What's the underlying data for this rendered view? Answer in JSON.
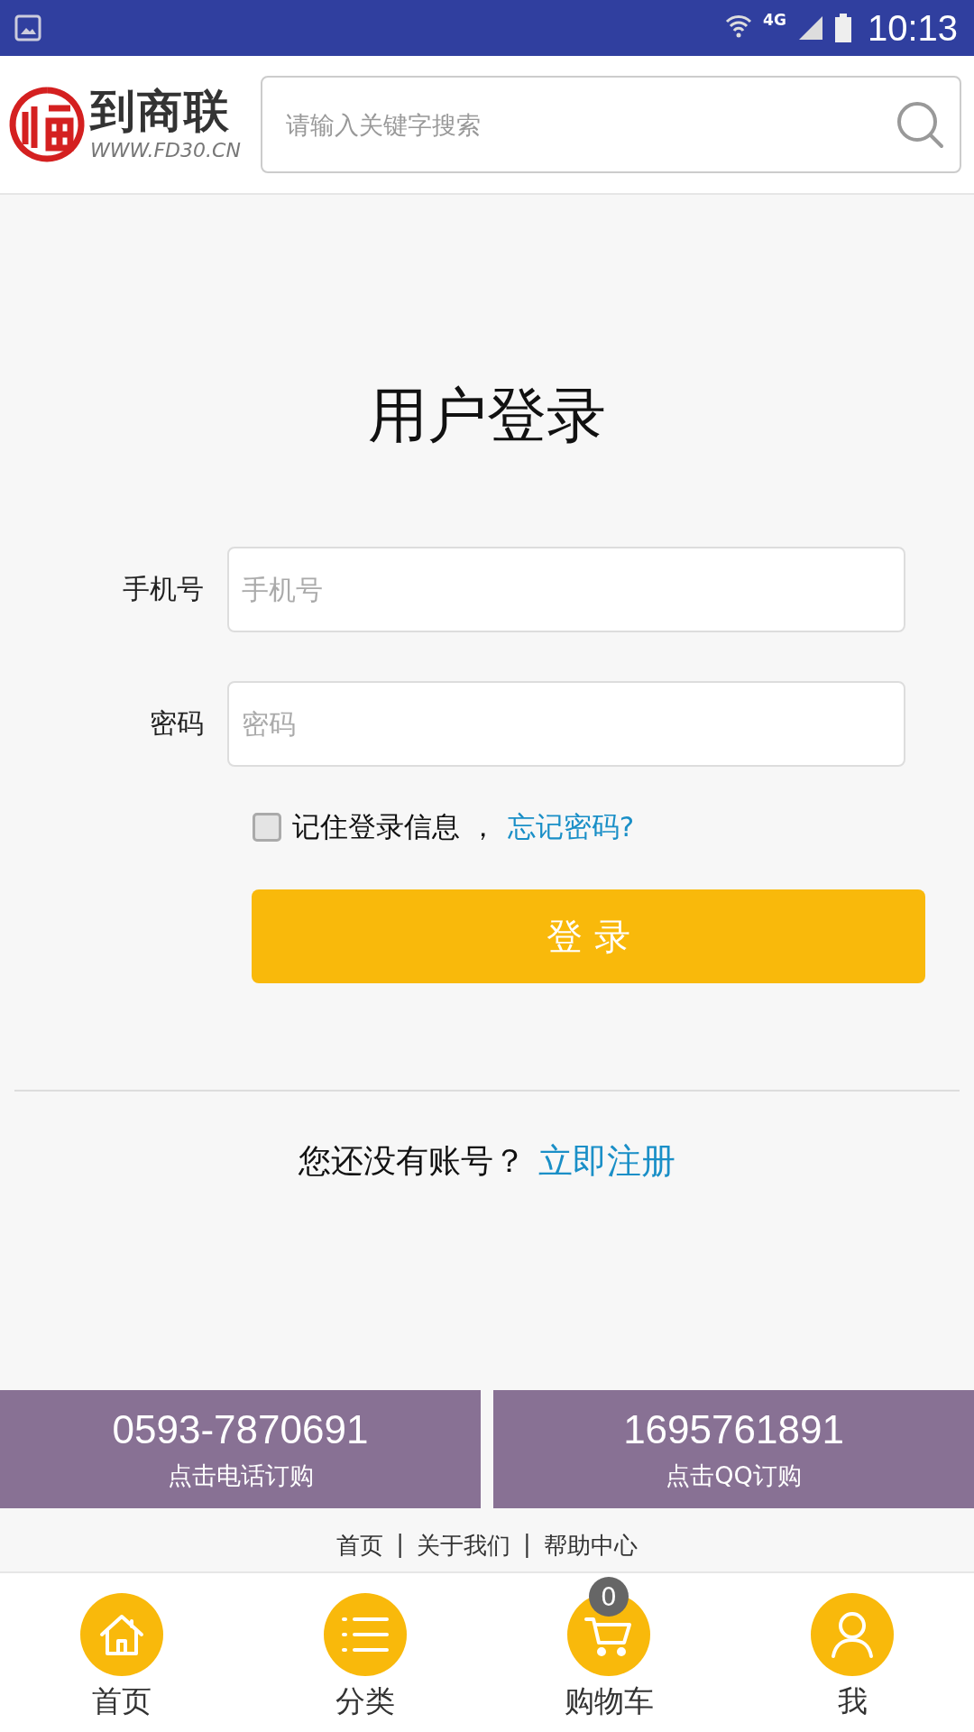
{
  "status_bar": {
    "network": "4G",
    "time": "10:13"
  },
  "header": {
    "logo_name": "到商联",
    "logo_url": "WWW.FD30.CN",
    "search": {
      "placeholder": "请输入关键字搜索"
    }
  },
  "login": {
    "title": "用户登录",
    "fields": [
      {
        "label": "手机号",
        "placeholder": "手机号"
      },
      {
        "label": "密码",
        "placeholder": "密码"
      }
    ],
    "remember": {
      "label": "记住登录信息 ，",
      "checked": false
    },
    "forgot_link": "忘记密码?",
    "submit": "登 录",
    "register_prompt": "您还没有账号？",
    "register_link": "立即注册"
  },
  "contact": [
    {
      "number": "0593-7870691",
      "caption": "点击电话订购"
    },
    {
      "number": "1695761891",
      "caption": "点击QQ订购"
    }
  ],
  "footer_links": [
    "首页",
    "关于我们",
    "帮助中心"
  ],
  "footer_separator": "|",
  "nav": [
    {
      "kind": "home",
      "label": "首页"
    },
    {
      "kind": "category",
      "label": "分类"
    },
    {
      "kind": "cart",
      "label": "购物车",
      "badge": "0"
    },
    {
      "kind": "user",
      "label": "我"
    }
  ]
}
